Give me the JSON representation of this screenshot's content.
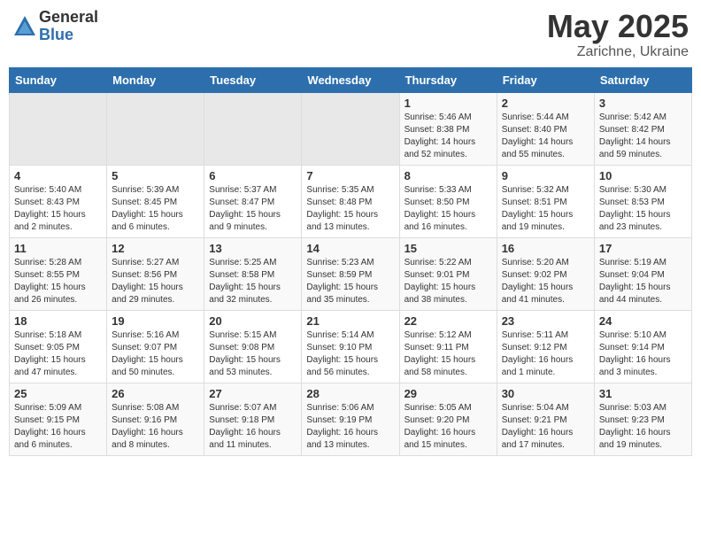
{
  "header": {
    "logo_general": "General",
    "logo_blue": "Blue",
    "month": "May 2025",
    "location": "Zarichne, Ukraine"
  },
  "days_of_week": [
    "Sunday",
    "Monday",
    "Tuesday",
    "Wednesday",
    "Thursday",
    "Friday",
    "Saturday"
  ],
  "weeks": [
    {
      "days": [
        {
          "number": "",
          "info": "",
          "empty": true
        },
        {
          "number": "",
          "info": "",
          "empty": true
        },
        {
          "number": "",
          "info": "",
          "empty": true
        },
        {
          "number": "",
          "info": "",
          "empty": true
        },
        {
          "number": "1",
          "info": "Sunrise: 5:46 AM\nSunset: 8:38 PM\nDaylight: 14 hours\nand 52 minutes."
        },
        {
          "number": "2",
          "info": "Sunrise: 5:44 AM\nSunset: 8:40 PM\nDaylight: 14 hours\nand 55 minutes."
        },
        {
          "number": "3",
          "info": "Sunrise: 5:42 AM\nSunset: 8:42 PM\nDaylight: 14 hours\nand 59 minutes."
        }
      ]
    },
    {
      "days": [
        {
          "number": "4",
          "info": "Sunrise: 5:40 AM\nSunset: 8:43 PM\nDaylight: 15 hours\nand 2 minutes."
        },
        {
          "number": "5",
          "info": "Sunrise: 5:39 AM\nSunset: 8:45 PM\nDaylight: 15 hours\nand 6 minutes."
        },
        {
          "number": "6",
          "info": "Sunrise: 5:37 AM\nSunset: 8:47 PM\nDaylight: 15 hours\nand 9 minutes."
        },
        {
          "number": "7",
          "info": "Sunrise: 5:35 AM\nSunset: 8:48 PM\nDaylight: 15 hours\nand 13 minutes."
        },
        {
          "number": "8",
          "info": "Sunrise: 5:33 AM\nSunset: 8:50 PM\nDaylight: 15 hours\nand 16 minutes."
        },
        {
          "number": "9",
          "info": "Sunrise: 5:32 AM\nSunset: 8:51 PM\nDaylight: 15 hours\nand 19 minutes."
        },
        {
          "number": "10",
          "info": "Sunrise: 5:30 AM\nSunset: 8:53 PM\nDaylight: 15 hours\nand 23 minutes."
        }
      ]
    },
    {
      "days": [
        {
          "number": "11",
          "info": "Sunrise: 5:28 AM\nSunset: 8:55 PM\nDaylight: 15 hours\nand 26 minutes."
        },
        {
          "number": "12",
          "info": "Sunrise: 5:27 AM\nSunset: 8:56 PM\nDaylight: 15 hours\nand 29 minutes."
        },
        {
          "number": "13",
          "info": "Sunrise: 5:25 AM\nSunset: 8:58 PM\nDaylight: 15 hours\nand 32 minutes."
        },
        {
          "number": "14",
          "info": "Sunrise: 5:23 AM\nSunset: 8:59 PM\nDaylight: 15 hours\nand 35 minutes."
        },
        {
          "number": "15",
          "info": "Sunrise: 5:22 AM\nSunset: 9:01 PM\nDaylight: 15 hours\nand 38 minutes."
        },
        {
          "number": "16",
          "info": "Sunrise: 5:20 AM\nSunset: 9:02 PM\nDaylight: 15 hours\nand 41 minutes."
        },
        {
          "number": "17",
          "info": "Sunrise: 5:19 AM\nSunset: 9:04 PM\nDaylight: 15 hours\nand 44 minutes."
        }
      ]
    },
    {
      "days": [
        {
          "number": "18",
          "info": "Sunrise: 5:18 AM\nSunset: 9:05 PM\nDaylight: 15 hours\nand 47 minutes."
        },
        {
          "number": "19",
          "info": "Sunrise: 5:16 AM\nSunset: 9:07 PM\nDaylight: 15 hours\nand 50 minutes."
        },
        {
          "number": "20",
          "info": "Sunrise: 5:15 AM\nSunset: 9:08 PM\nDaylight: 15 hours\nand 53 minutes."
        },
        {
          "number": "21",
          "info": "Sunrise: 5:14 AM\nSunset: 9:10 PM\nDaylight: 15 hours\nand 56 minutes."
        },
        {
          "number": "22",
          "info": "Sunrise: 5:12 AM\nSunset: 9:11 PM\nDaylight: 15 hours\nand 58 minutes."
        },
        {
          "number": "23",
          "info": "Sunrise: 5:11 AM\nSunset: 9:12 PM\nDaylight: 16 hours\nand 1 minute."
        },
        {
          "number": "24",
          "info": "Sunrise: 5:10 AM\nSunset: 9:14 PM\nDaylight: 16 hours\nand 3 minutes."
        }
      ]
    },
    {
      "days": [
        {
          "number": "25",
          "info": "Sunrise: 5:09 AM\nSunset: 9:15 PM\nDaylight: 16 hours\nand 6 minutes."
        },
        {
          "number": "26",
          "info": "Sunrise: 5:08 AM\nSunset: 9:16 PM\nDaylight: 16 hours\nand 8 minutes."
        },
        {
          "number": "27",
          "info": "Sunrise: 5:07 AM\nSunset: 9:18 PM\nDaylight: 16 hours\nand 11 minutes."
        },
        {
          "number": "28",
          "info": "Sunrise: 5:06 AM\nSunset: 9:19 PM\nDaylight: 16 hours\nand 13 minutes."
        },
        {
          "number": "29",
          "info": "Sunrise: 5:05 AM\nSunset: 9:20 PM\nDaylight: 16 hours\nand 15 minutes."
        },
        {
          "number": "30",
          "info": "Sunrise: 5:04 AM\nSunset: 9:21 PM\nDaylight: 16 hours\nand 17 minutes."
        },
        {
          "number": "31",
          "info": "Sunrise: 5:03 AM\nSunset: 9:23 PM\nDaylight: 16 hours\nand 19 minutes."
        }
      ]
    }
  ]
}
